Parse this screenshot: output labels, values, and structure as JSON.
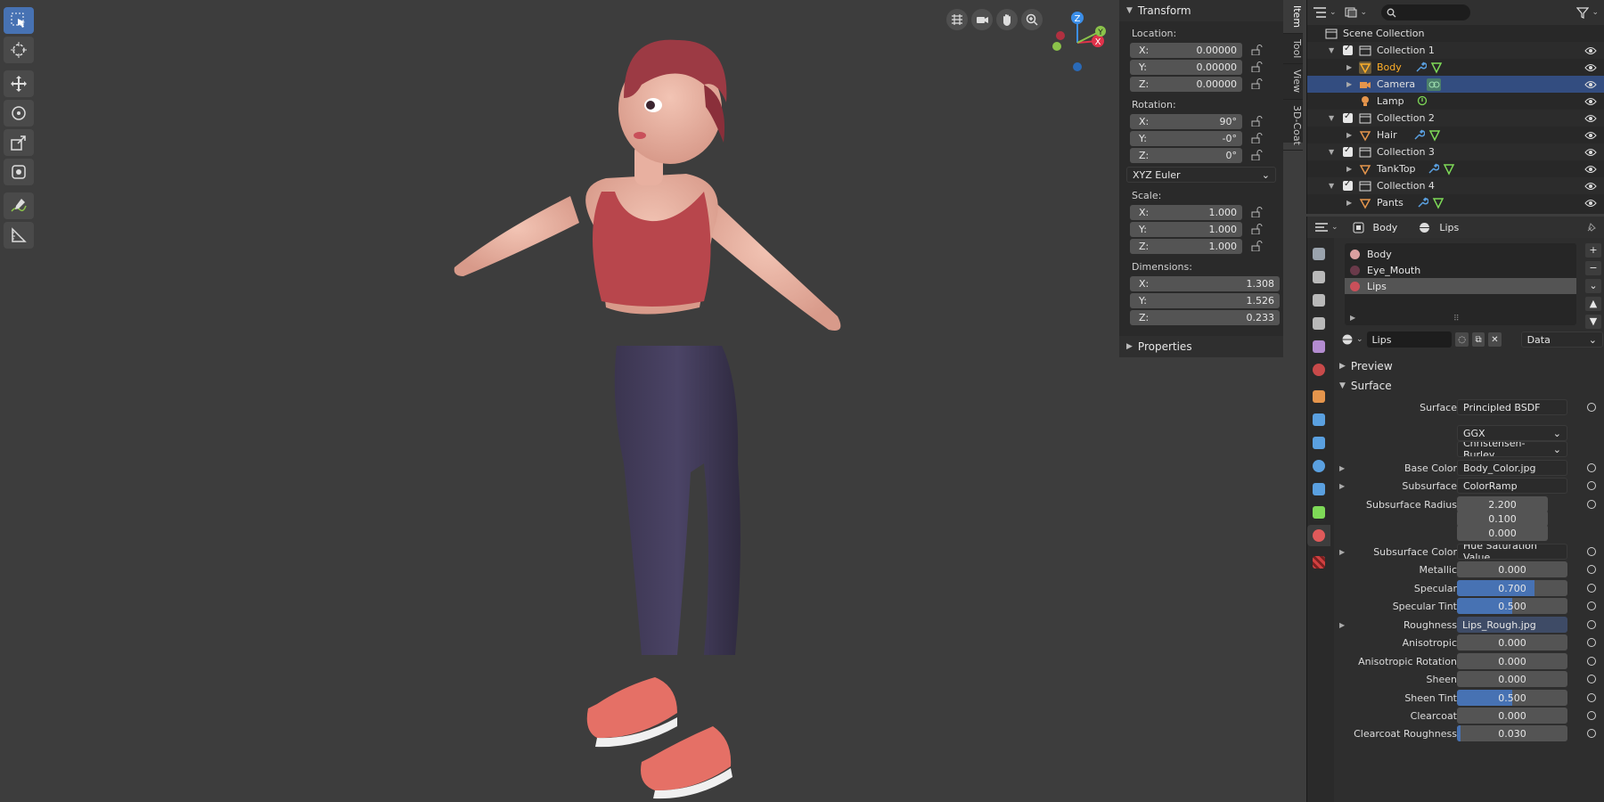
{
  "viewport": {
    "gizmo": {
      "x": "X",
      "y": "Y",
      "z": "Z"
    },
    "tools": [
      "select-box-icon",
      "cursor-icon",
      "move-icon",
      "rotate-icon",
      "scale-icon",
      "transform-icon",
      "annotate-icon",
      "measure-icon"
    ],
    "nav_icons": [
      "grid-view-icon",
      "camera-view-icon",
      "pan-hand-icon",
      "zoom-icon"
    ]
  },
  "npanel": {
    "transform_title": "Transform",
    "location_label": "Location:",
    "location": [
      {
        "axis": "X:",
        "value": "0.00000"
      },
      {
        "axis": "Y:",
        "value": "0.00000"
      },
      {
        "axis": "Z:",
        "value": "0.00000"
      }
    ],
    "rotation_label": "Rotation:",
    "rotation": [
      {
        "axis": "X:",
        "value": "90°"
      },
      {
        "axis": "Y:",
        "value": "-0°"
      },
      {
        "axis": "Z:",
        "value": "0°"
      }
    ],
    "rotation_mode": "XYZ Euler",
    "scale_label": "Scale:",
    "scale": [
      {
        "axis": "X:",
        "value": "1.000"
      },
      {
        "axis": "Y:",
        "value": "1.000"
      },
      {
        "axis": "Z:",
        "value": "1.000"
      }
    ],
    "dimensions_label": "Dimensions:",
    "dimensions": [
      {
        "axis": "X:",
        "value": "1.308"
      },
      {
        "axis": "Y:",
        "value": "1.526"
      },
      {
        "axis": "Z:",
        "value": "0.233"
      }
    ],
    "properties_title": "Properties"
  },
  "sidetabs": [
    "Item",
    "Tool",
    "View",
    "3D-Coat"
  ],
  "outliner": {
    "search_placeholder": "",
    "rows": [
      {
        "name": "Scene Collection",
        "kind": "scene"
      },
      {
        "name": "Collection 1",
        "kind": "collection"
      },
      {
        "name": "Body",
        "kind": "mesh",
        "active": true
      },
      {
        "name": "Camera",
        "kind": "camera",
        "selected": true
      },
      {
        "name": "Lamp",
        "kind": "lamp"
      },
      {
        "name": "Collection 2",
        "kind": "collection"
      },
      {
        "name": "Hair",
        "kind": "mesh"
      },
      {
        "name": "Collection 3",
        "kind": "collection"
      },
      {
        "name": "TankTop",
        "kind": "mesh"
      },
      {
        "name": "Collection 4",
        "kind": "collection"
      },
      {
        "name": "Pants",
        "kind": "mesh"
      }
    ]
  },
  "properties": {
    "breadcrumb_object": "Body",
    "breadcrumb_material": "Lips",
    "slots": [
      "Body",
      "Eye_Mouth",
      "Lips"
    ],
    "material_name": "Lips",
    "data_mode": "Data",
    "preview_label": "Preview",
    "surface_label": "Surface",
    "rows": [
      {
        "label": "Surface",
        "value": "Principled BSDF",
        "type": "link"
      },
      {
        "label": "",
        "value": "GGX",
        "type": "select"
      },
      {
        "label": "",
        "value": "Christensen-Burley",
        "type": "select"
      },
      {
        "label": "Base Color",
        "value": "Body_Color.jpg",
        "type": "link"
      },
      {
        "label": "Subsurface",
        "value": "ColorRamp",
        "type": "link"
      },
      {
        "label": "Subsurface Radius",
        "value": "2.200",
        "type": "num"
      },
      {
        "label": "",
        "value": "0.100",
        "type": "num"
      },
      {
        "label": "",
        "value": "0.000",
        "type": "num"
      },
      {
        "label": "Subsurface Color",
        "value": "Hue Saturation Value",
        "type": "link"
      },
      {
        "label": "Metallic",
        "value": "0.000",
        "type": "num"
      },
      {
        "label": "Specular",
        "value": "0.700",
        "type": "fill",
        "fill": 0.7
      },
      {
        "label": "Specular Tint",
        "value": "0.500",
        "type": "fill",
        "fill": 0.5
      },
      {
        "label": "Roughness",
        "value": "Lips_Rough.jpg",
        "type": "img"
      },
      {
        "label": "Anisotropic",
        "value": "0.000",
        "type": "num"
      },
      {
        "label": "Anisotropic Rotation",
        "value": "0.000",
        "type": "num"
      },
      {
        "label": "Sheen",
        "value": "0.000",
        "type": "num"
      },
      {
        "label": "Sheen Tint",
        "value": "0.500",
        "type": "fill",
        "fill": 0.5
      },
      {
        "label": "Clearcoat",
        "value": "0.000",
        "type": "num"
      },
      {
        "label": "Clearcoat Roughness",
        "value": "0.030",
        "type": "fill",
        "fill": 0.03
      }
    ]
  },
  "colors": {
    "accent": "#4772b3",
    "active_object": "#ffaf29",
    "x_axis": "#e0324a",
    "y_axis": "#8bc34a",
    "z_axis": "#3b8ee8"
  }
}
